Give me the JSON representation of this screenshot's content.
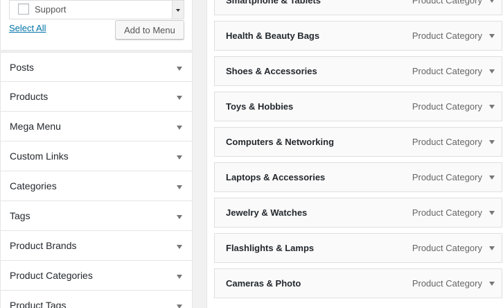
{
  "left_panel": {
    "checklist_item": "Support",
    "select_all": "Select All",
    "add_button": "Add to Menu",
    "sections": [
      {
        "label": "Posts"
      },
      {
        "label": "Products"
      },
      {
        "label": "Mega Menu"
      },
      {
        "label": "Custom Links"
      },
      {
        "label": "Categories"
      },
      {
        "label": "Tags"
      },
      {
        "label": "Product Brands"
      },
      {
        "label": "Product Categories"
      },
      {
        "label": "Product Tags"
      }
    ]
  },
  "menu_structure": {
    "items": [
      {
        "title": "Smartphone & Tablets",
        "type": "Product Category"
      },
      {
        "title": "Health & Beauty Bags",
        "type": "Product Category"
      },
      {
        "title": "Shoes & Accessories",
        "type": "Product Category"
      },
      {
        "title": "Toys & Hobbies",
        "type": "Product Category"
      },
      {
        "title": "Computers & Networking",
        "type": "Product Category"
      },
      {
        "title": "Laptops & Accessories",
        "type": "Product Category"
      },
      {
        "title": "Jewelry & Watches",
        "type": "Product Category"
      },
      {
        "title": "Flashlights & Lamps",
        "type": "Product Category"
      },
      {
        "title": "Cameras & Photo",
        "type": "Product Category"
      }
    ]
  },
  "colors": {
    "link": "#0073aa",
    "background": "#f1f1f1",
    "panel": "#ffffff"
  }
}
